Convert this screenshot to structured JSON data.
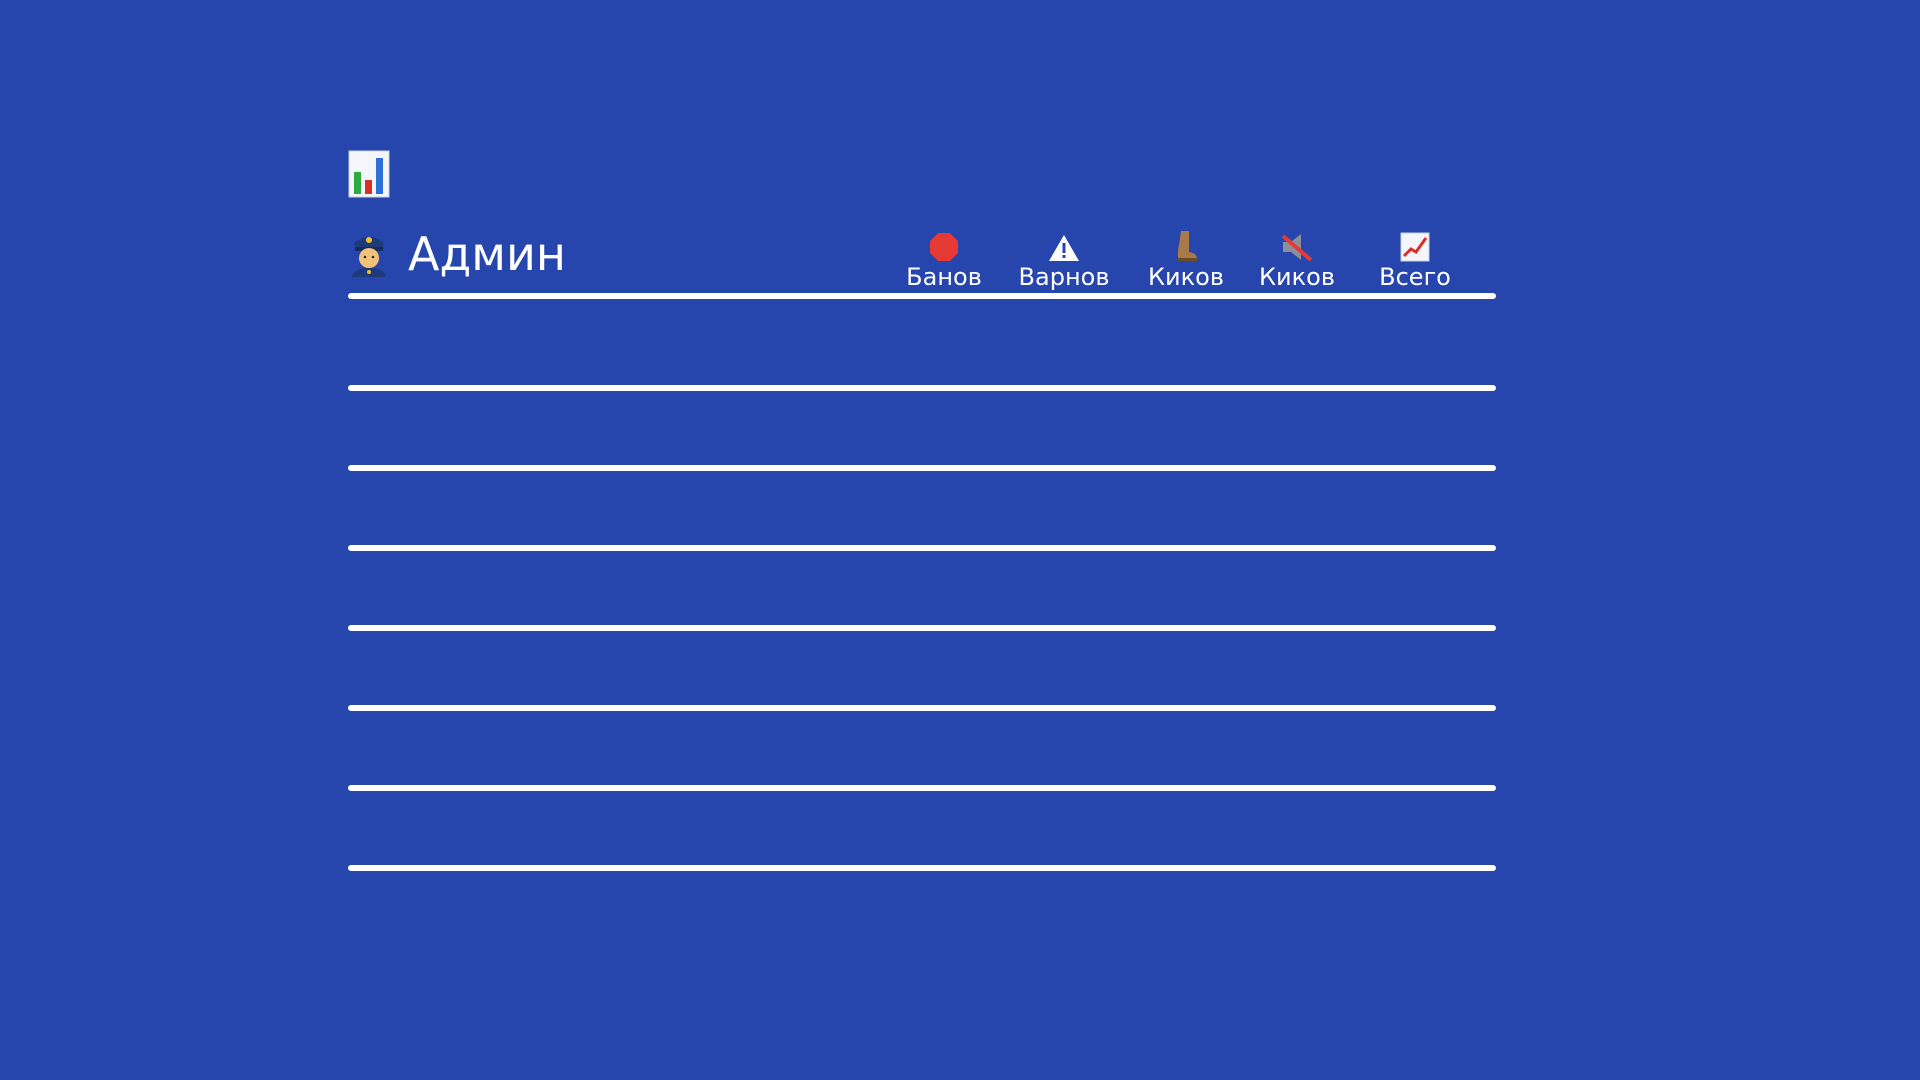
{
  "header": {
    "chart_icon": "bar-chart-icon",
    "admin_icon": "police-officer-icon",
    "admin_label": "Админ"
  },
  "columns": [
    {
      "icon": "stop-sign-icon",
      "label": "Банов"
    },
    {
      "icon": "warning-icon",
      "label": "Варнов"
    },
    {
      "icon": "boot-icon",
      "label": "Киков"
    },
    {
      "icon": "muted-speaker-icon",
      "label": "Киков"
    },
    {
      "icon": "chart-increasing-icon",
      "label": "Всего"
    }
  ],
  "rows": [],
  "colors": {
    "background": "#2646ad",
    "text": "#ffffff",
    "stop": "#e53935",
    "warning": "#ffffff"
  }
}
